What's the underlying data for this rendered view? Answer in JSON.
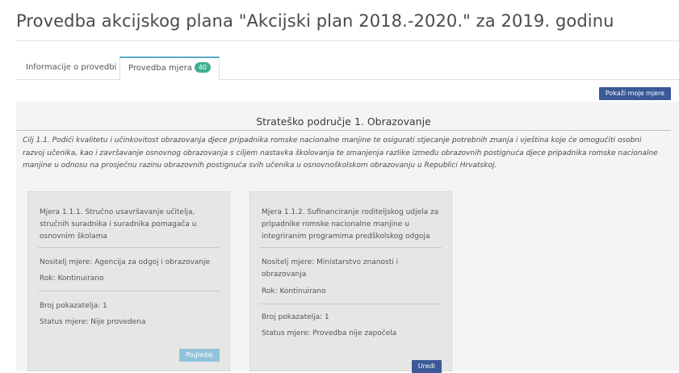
{
  "page": {
    "title": "Provedba akcijskog plana \"Akcijski plan 2018.-2020.\" za 2019. godinu"
  },
  "tabs": [
    {
      "label": "Informacije o provedbi"
    },
    {
      "label": "Provedba mjera",
      "badge": "40"
    }
  ],
  "toolbar": {
    "show_my_measures_label": "Pokaži moje mjere"
  },
  "area": {
    "title": "Strateško područje 1. Obrazovanje",
    "goal": "Cilj 1.1. Podići kvalitetu i učinkovitost obrazovanja djece pripadnika romske nacionalne manjine te osigurati stjecanje potrebnih znanja i vještina koje će omogućiti osobni razvoj učenika, kao i završavanje osnovnog obrazovanja s ciljem nastavka školovanja te smanjenja razlike između obrazovnih postignuća djece pripadnika romske nacionalne manjine u odnosu na prosječnu razinu obrazovnih postignuća svih učenika u osnovnoškolskom obrazovanju u Republici Hrvatskoj."
  },
  "measures": [
    {
      "title": "Mjera 1.1.1. Stručno usavršavanje učitelja, stručnih suradnika i suradnika pomagača u osnovnim školama",
      "holder": "Nositelj mjere: Agencija za odgoj i obrazovanje",
      "deadline": "Rok: Kontinuirano",
      "indicators": "Broj pokazatelja: 1",
      "status": "Status mjere: Nije provedena",
      "button": "Pogledaj"
    },
    {
      "title": "Mjera 1.1.2. Sufinanciranje roditeljskog udjela za pripadnike romske nacionalne manjine u integriranim programima predškolskog odgoja",
      "holder": "Nositelj mjere: Ministarstvo znanosti i obrazovanja",
      "deadline": "Rok: Kontinuirano",
      "indicators": "Broj pokazatelja: 1",
      "status": "Status mjere: Provedba nije započela",
      "button": "Uredi"
    }
  ],
  "colors": {
    "accent": "#3b5998",
    "badge": "#3fb18f",
    "light_button": "#8fc3db"
  }
}
